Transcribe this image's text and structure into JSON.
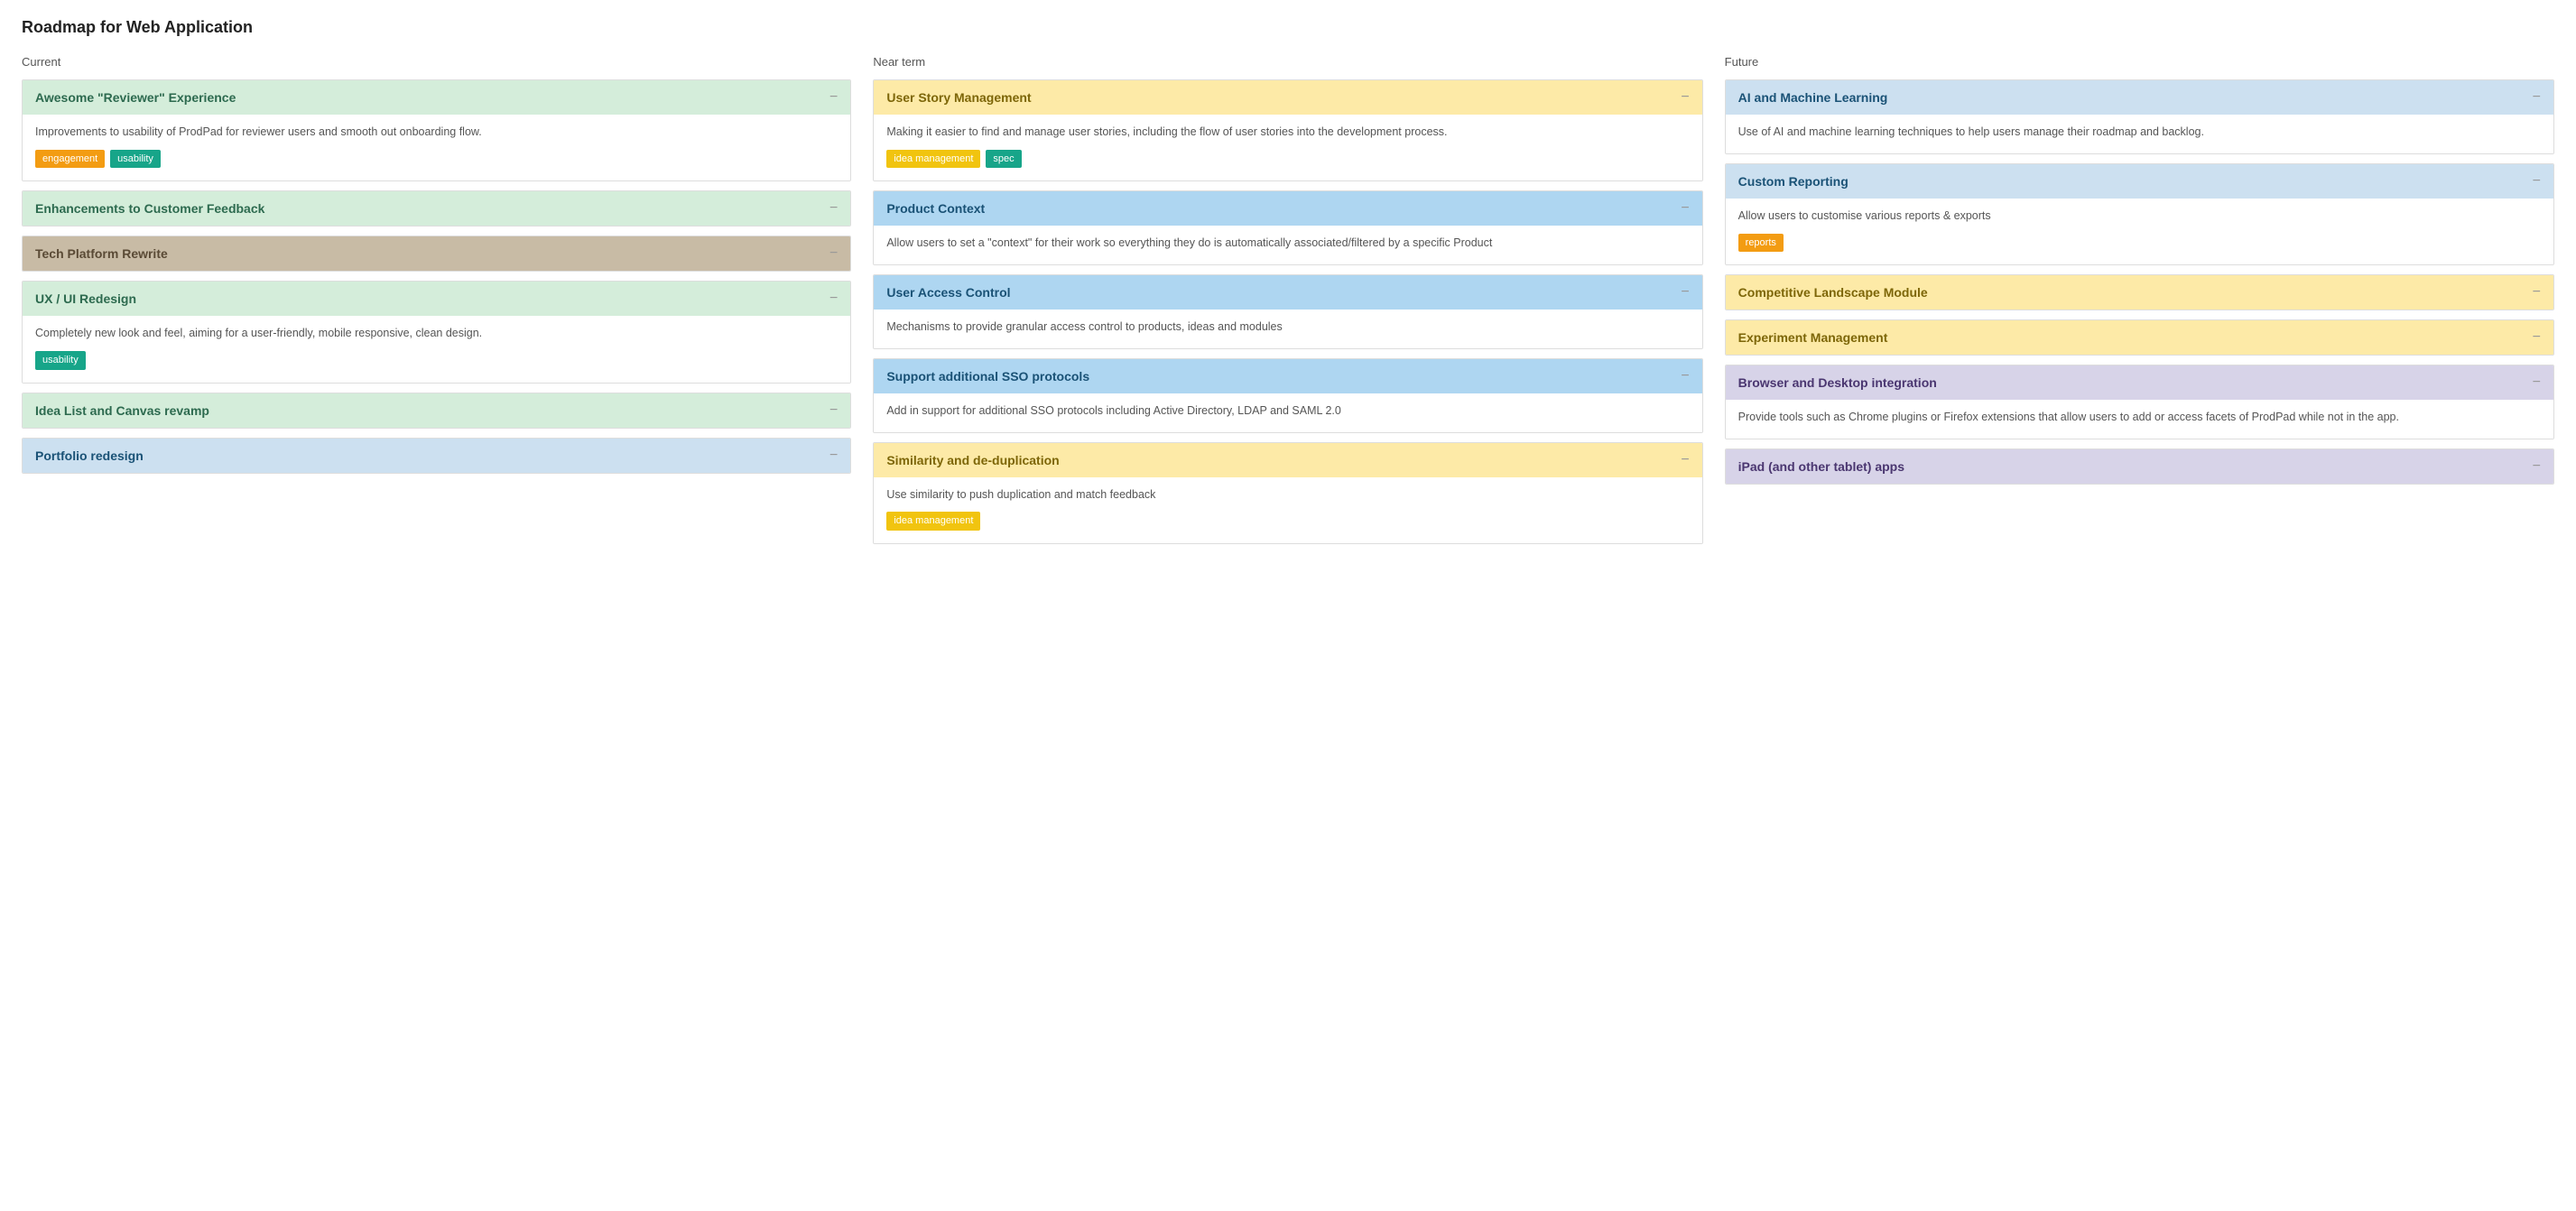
{
  "page": {
    "title": "Roadmap for Web Application"
  },
  "columns": [
    {
      "id": "current",
      "label": "Current",
      "cards": [
        {
          "id": "awesome-reviewer",
          "title": "Awesome \"Reviewer\" Experience",
          "color": "green",
          "body": "Improvements to usability of ProdPad for reviewer users and smooth out onboarding flow.",
          "tags": [
            {
              "label": "engagement",
              "style": "orange"
            },
            {
              "label": "usability",
              "style": "teal"
            }
          ]
        },
        {
          "id": "enhancements-customer-feedback",
          "title": "Enhancements to Customer Feedback",
          "color": "green",
          "body": "",
          "tags": []
        },
        {
          "id": "tech-platform-rewrite",
          "title": "Tech Platform Rewrite",
          "color": "tan",
          "body": "",
          "tags": []
        },
        {
          "id": "ux-ui-redesign",
          "title": "UX / UI Redesign",
          "color": "green",
          "body": "Completely new look and feel, aiming for a user-friendly, mobile responsive, clean design.",
          "tags": [
            {
              "label": "usability",
              "style": "teal"
            }
          ]
        },
        {
          "id": "idea-list-canvas-revamp",
          "title": "Idea List and Canvas revamp",
          "color": "green",
          "body": "",
          "tags": []
        },
        {
          "id": "portfolio-redesign",
          "title": "Portfolio redesign",
          "color": "lightblue",
          "body": "",
          "tags": []
        }
      ]
    },
    {
      "id": "near-term",
      "label": "Near term",
      "cards": [
        {
          "id": "user-story-management",
          "title": "User Story Management",
          "color": "yellow",
          "body": "Making it easier to find and manage user stories, including the flow of user stories into the development process.",
          "tags": [
            {
              "label": "idea management",
              "style": "yellow"
            },
            {
              "label": "spec",
              "style": "teal"
            }
          ]
        },
        {
          "id": "product-context",
          "title": "Product Context",
          "color": "blue",
          "body": "Allow users to set a \"context\" for their work so everything they do is automatically associated/filtered by a specific Product",
          "tags": []
        },
        {
          "id": "user-access-control",
          "title": "User Access Control",
          "color": "blue",
          "body": "Mechanisms to provide granular access control to products, ideas and modules",
          "tags": []
        },
        {
          "id": "support-sso-protocols",
          "title": "Support additional SSO protocols",
          "color": "blue",
          "body": "Add in support for additional SSO protocols including Active Directory, LDAP and SAML 2.0",
          "tags": []
        },
        {
          "id": "similarity-deduplication",
          "title": "Similarity and de-duplication",
          "color": "yellow",
          "body": "Use similarity to push duplication and match feedback",
          "tags": [
            {
              "label": "idea management",
              "style": "yellow"
            }
          ]
        }
      ]
    },
    {
      "id": "future",
      "label": "Future",
      "cards": [
        {
          "id": "ai-machine-learning",
          "title": "AI and Machine Learning",
          "color": "lightblue",
          "body": "Use of AI and machine learning techniques to help users manage their roadmap and backlog.",
          "tags": []
        },
        {
          "id": "custom-reporting",
          "title": "Custom Reporting",
          "color": "lightblue",
          "body": "Allow users to customise various reports & exports",
          "tags": [
            {
              "label": "reports",
              "style": "orange"
            }
          ]
        },
        {
          "id": "competitive-landscape-module",
          "title": "Competitive Landscape Module",
          "color": "yellow",
          "body": "",
          "tags": []
        },
        {
          "id": "experiment-management",
          "title": "Experiment Management",
          "color": "yellow",
          "body": "",
          "tags": []
        },
        {
          "id": "browser-desktop-integration",
          "title": "Browser and Desktop integration",
          "color": "lavender",
          "body": "Provide tools such as Chrome plugins or Firefox extensions that allow users to add or access facets of ProdPad while not in the app.",
          "tags": []
        },
        {
          "id": "ipad-tablet-apps",
          "title": "iPad (and other tablet) apps",
          "color": "lavender",
          "body": "",
          "tags": []
        }
      ]
    }
  ],
  "minus_label": "−"
}
